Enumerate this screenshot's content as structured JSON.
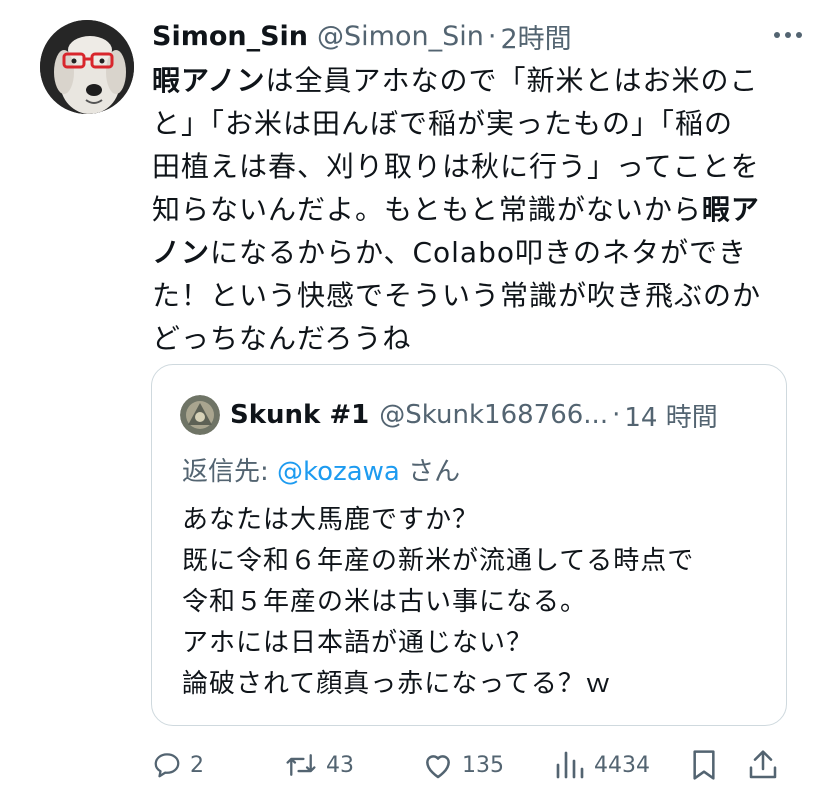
{
  "tweet": {
    "author_name": "Simon_Sin",
    "handle": "@Simon_Sin",
    "separator": "·",
    "time": "2時間",
    "lines": [
      {
        "bold": "暇アノン",
        "text": "は全員アホなので「新米とはお米のこ",
        "bold_after": ""
      },
      {
        "bold": "",
        "text": "と」「お米は田んぼで稲が実ったもの」「稲の",
        "bold_after": ""
      },
      {
        "bold": "",
        "text": "田植えは春、刈り取りは秋に行う」ってことを",
        "bold_after": ""
      },
      {
        "bold": "",
        "text": "知らないんだよ。もともと常識がないから",
        "bold_after": "暇ア"
      },
      {
        "bold": "ノン",
        "text": "になるからか、Colabo叩きのネタができ",
        "bold_after": ""
      },
      {
        "bold": "",
        "text": "た！という快感でそういう常識が吹き飛ぶのか",
        "bold_after": ""
      },
      {
        "bold": "",
        "text": "どっちなんだろうね",
        "bold_after": ""
      }
    ]
  },
  "quote": {
    "author_name": "Skunk #1",
    "handle": "@Skunk168766...",
    "separator": "·",
    "time": "14 時間",
    "reply_prefix": "返信先: ",
    "reply_mention": "@kozawa",
    "reply_suffix": " さん",
    "lines": [
      "あなたは大馬鹿ですか？",
      "既に令和６年産の新米が流通してる時点で",
      "令和５年産の米は古い事になる。",
      "アホには日本語が通じない？",
      "論破されて顔真っ赤になってる？ｗ"
    ]
  },
  "actions": {
    "reply_count": "2",
    "retweet_count": "43",
    "like_count": "135",
    "views_count": "4434"
  },
  "icons": {
    "more": "more-dots-icon",
    "reply": "reply-bubble-icon",
    "retweet": "retweet-icon",
    "like": "heart-icon",
    "views": "views-bar-icon",
    "bookmark": "bookmark-icon",
    "share": "share-upload-icon"
  },
  "colors": {
    "text": "#0f1419",
    "secondary": "#536471",
    "link": "#1d9bf0",
    "border": "#cfd9de"
  }
}
